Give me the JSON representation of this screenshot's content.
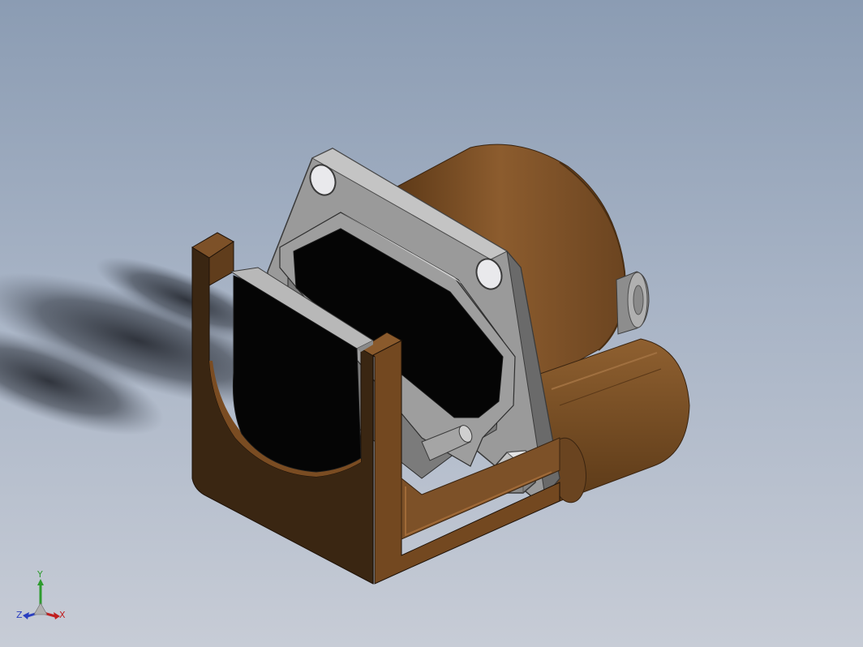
{
  "viewport": {
    "background_top": "#8b9cb3",
    "background_bottom": "#c7ccd6"
  },
  "model": {
    "colors": {
      "bronze_light": "#8a5a2c",
      "bronze_mid": "#734820",
      "bronze_dark": "#3a2612",
      "steel_light": "#b9b9b9",
      "steel_mid": "#8c8c8c",
      "steel_dark": "#5c5c5c",
      "pad_black": "#050505"
    }
  },
  "triad": {
    "y_label": "Y",
    "x_label": "X",
    "z_label": "Z",
    "y_color": "#2e9b2e",
    "x_color": "#c02020",
    "z_color": "#2a3fc0"
  }
}
